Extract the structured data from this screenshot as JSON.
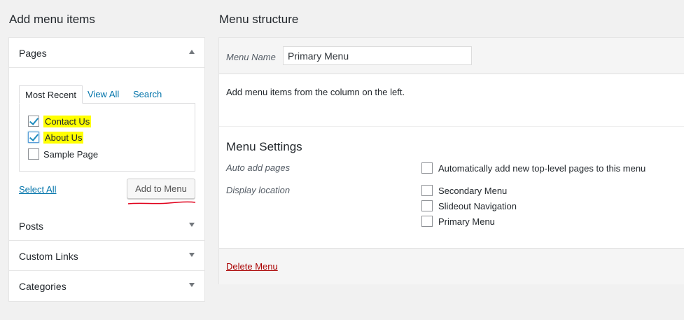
{
  "left": {
    "heading": "Add menu items",
    "pages": {
      "title": "Pages",
      "tabs": [
        "Most Recent",
        "View All",
        "Search"
      ],
      "items": [
        {
          "label": "Contact Us",
          "checked": true,
          "highlighted": true
        },
        {
          "label": "About Us",
          "checked": true,
          "highlighted": true
        },
        {
          "label": "Sample Page",
          "checked": false,
          "highlighted": false
        }
      ],
      "select_all": "Select All",
      "add_button": "Add to Menu"
    },
    "sections": [
      "Posts",
      "Custom Links",
      "Categories"
    ]
  },
  "right": {
    "heading": "Menu structure",
    "menu_name_label": "Menu Name",
    "menu_name_value": "Primary Menu",
    "instructions": "Add menu items from the column on the left.",
    "settings_title": "Menu Settings",
    "auto_add_label": "Auto add pages",
    "auto_add_option": "Automatically add new top-level pages to this menu",
    "display_location_label": "Display location",
    "locations": [
      "Secondary Menu",
      "Slideout Navigation",
      "Primary Menu"
    ],
    "delete_link": "Delete Menu"
  },
  "colors": {
    "link": "#0073aa",
    "delete": "#aa0000",
    "highlight": "#ffff00",
    "annotation": "#e0001b"
  }
}
